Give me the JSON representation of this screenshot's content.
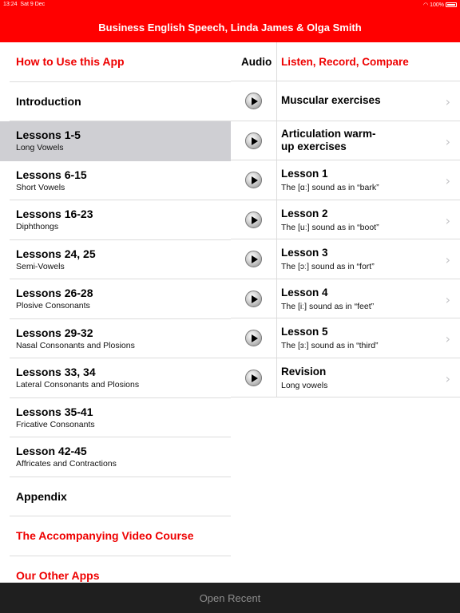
{
  "status_bar": {
    "time": "13:24",
    "date": "Sat 9 Dec",
    "battery": "100%"
  },
  "header": {
    "title": "Business English Speech, Linda James & Olga Smith"
  },
  "left_menu": [
    {
      "title": "How to Use this App",
      "subtitle": "",
      "style": "red"
    },
    {
      "title": "Introduction",
      "subtitle": ""
    },
    {
      "title": "Lessons 1-5",
      "subtitle": "Long Vowels",
      "selected": true
    },
    {
      "title": "Lessons 6-15",
      "subtitle": "Short Vowels"
    },
    {
      "title": "Lessons 16-23",
      "subtitle": "Diphthongs"
    },
    {
      "title": "Lessons 24, 25",
      "subtitle": "Semi-Vowels"
    },
    {
      "title": "Lessons 26-28",
      "subtitle": "Plosive Consonants"
    },
    {
      "title": "Lessons 29-32",
      "subtitle": "Nasal Consonants and Plosions"
    },
    {
      "title": "Lessons 33, 34",
      "subtitle": "Lateral Consonants and Plosions"
    },
    {
      "title": "Lessons 35-41",
      "subtitle": "Fricative Consonants"
    },
    {
      "title": "Lesson 42-45",
      "subtitle": "Affricates and Contractions"
    },
    {
      "title": "Appendix",
      "subtitle": ""
    },
    {
      "title": "The Accompanying Video Course",
      "subtitle": "",
      "style": "red"
    },
    {
      "title": "Our Other Apps",
      "subtitle": "",
      "style": "red"
    }
  ],
  "right_panel": {
    "audio_label": "Audio",
    "listen_label": "Listen, Record, Compare",
    "items": [
      {
        "title": "Muscular exercises",
        "subtitle": ""
      },
      {
        "title": "Articulation warm-\nup exercises",
        "subtitle": ""
      },
      {
        "title": "Lesson 1",
        "subtitle": "The [ɑː] sound as in “bark”"
      },
      {
        "title": "Lesson 2",
        "subtitle": "The [uː] sound as in “boot”"
      },
      {
        "title": "Lesson 3",
        "subtitle": "The [ɔː] sound as in “fort”"
      },
      {
        "title": "Lesson 4",
        "subtitle": "The [iː] sound as in “feet”"
      },
      {
        "title": "Lesson 5",
        "subtitle": "The [ɜː] sound as in “third”"
      },
      {
        "title": "Revision",
        "subtitle": "Long vowels"
      }
    ]
  },
  "footer": {
    "open_recent_label": "Open Recent"
  },
  "icons": {
    "play": "play-icon",
    "chevron": "chevron-right-icon",
    "battery": "battery-icon",
    "wifi": "wifi-icon"
  },
  "colors": {
    "accent": "#ff0000",
    "selected_row": "#cfcfd3",
    "footer": "#1f1f1f"
  }
}
